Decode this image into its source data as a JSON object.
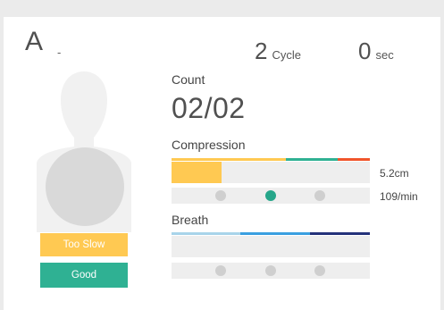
{
  "header": {
    "student_id": "A",
    "student_name": "-",
    "cycles_value": "2",
    "cycles_unit": "Cycle",
    "time_value": "0",
    "time_unit": "sec"
  },
  "count": {
    "label": "Count",
    "value": "02/02"
  },
  "compression": {
    "label": "Compression",
    "depth_text": "5.2cm",
    "rate_text": "109/min",
    "depth_fill_fraction": 0.25,
    "rate_active_dot": 1,
    "zone_colors": [
      "#ffc952",
      "#2fb193",
      "#f0552b"
    ]
  },
  "breath": {
    "label": "Breath",
    "zone_colors": [
      "#a8d4ea",
      "#3a9fe0",
      "#24327a"
    ]
  },
  "status": {
    "rate_label": "Too Slow",
    "rate_color": "#ffc952",
    "overall_label": "Good",
    "overall_color": "#2fb193"
  },
  "colors": {
    "background": "#ebebeb",
    "card": "#ffffff",
    "track": "#eeeeee",
    "dot_inactive": "#cfcfcf",
    "dot_active": "#26a68a",
    "mannequin": "#f1f1f1",
    "chest_circle": "#d9d9d9"
  }
}
